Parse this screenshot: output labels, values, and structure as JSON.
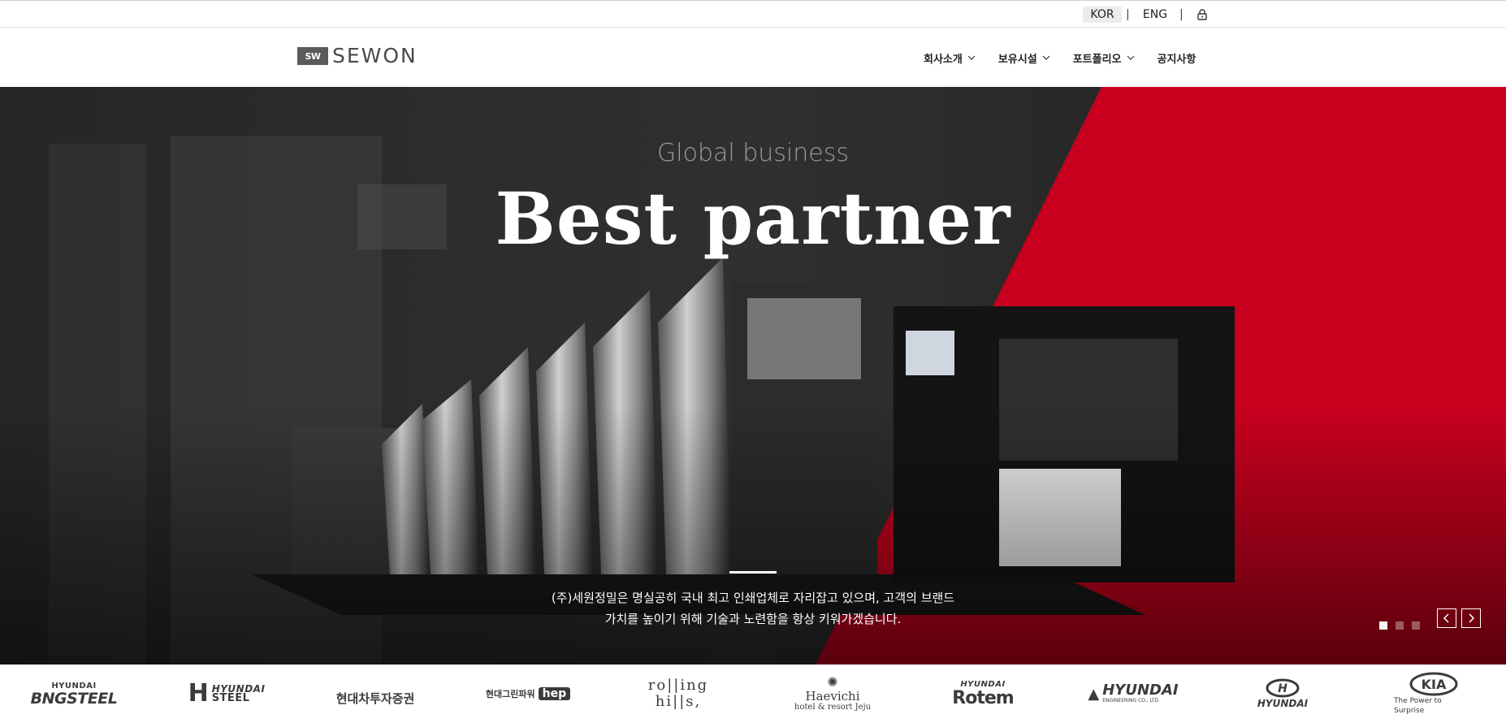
{
  "topbar": {
    "lang_kor": "KOR",
    "separator": "|",
    "lang_eng": "ENG",
    "lock_icon": "lock-icon"
  },
  "header": {
    "logo_mark": "SW",
    "logo_text": "SEWON",
    "nav": [
      {
        "label": "회사소개",
        "has_dropdown": true
      },
      {
        "label": "보유시설",
        "has_dropdown": true
      },
      {
        "label": "포트폴리오",
        "has_dropdown": true
      },
      {
        "label": "공지사항",
        "has_dropdown": false
      }
    ]
  },
  "hero": {
    "subtitle": "Global business",
    "title": "Best partner",
    "description_line1": "(주)세원정밀은 명실공히 국내 최고 인쇄업체로 자리잡고 있으며, 고객의 브랜드",
    "description_line2": "가치를 높이기 위해 기술과 노련함을 항상 키워가겠습니다.",
    "slide_count": 3,
    "active_slide": 1,
    "accent_color": "#c8001e"
  },
  "partners": [
    {
      "top": "HYUNDAI",
      "main": "BNGSTEEL"
    },
    {
      "top": "HYUNDAI",
      "main": "STEEL"
    },
    {
      "top": "",
      "main": "현대차투자증권"
    },
    {
      "top": "현대그린파워",
      "main": "hep"
    },
    {
      "top": "ro||ing",
      "main": "hi||s,"
    },
    {
      "top": "Haevichi",
      "main": "hotel & resort Jeju"
    },
    {
      "top": "HYUNDAI",
      "main": "Rotem"
    },
    {
      "top": "HYUNDAI",
      "main": "ENGINEERING CO., LTD"
    },
    {
      "top": "",
      "main": "HYUNDAI"
    },
    {
      "top": "KIA",
      "main": "The Power to Surprise"
    }
  ]
}
